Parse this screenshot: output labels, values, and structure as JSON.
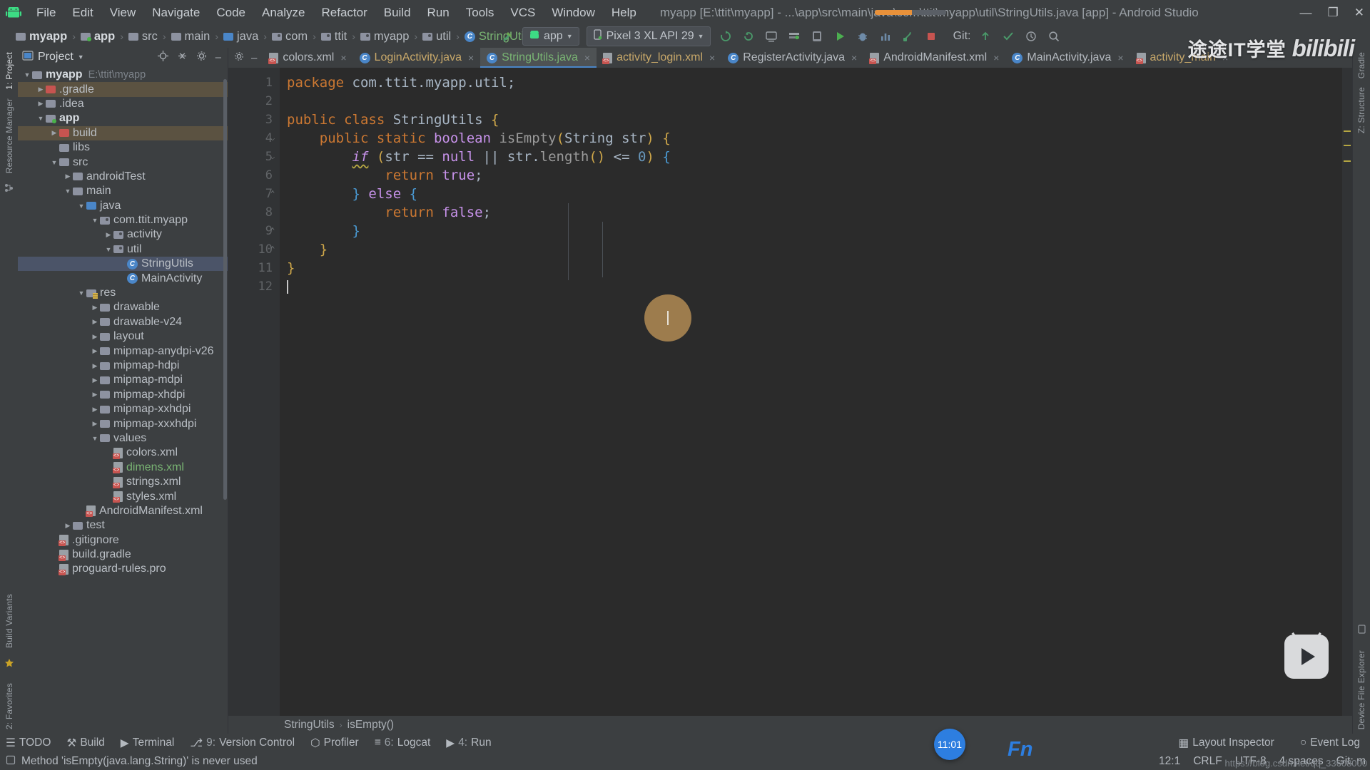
{
  "titlebar": {
    "app_icon": "android-robot-icon",
    "menus": [
      "File",
      "Edit",
      "View",
      "Navigate",
      "Code",
      "Analyze",
      "Refactor",
      "Build",
      "Run",
      "Tools",
      "VCS",
      "Window",
      "Help"
    ],
    "window_title": "myapp [E:\\ttit\\myapp] - ...\\app\\src\\main\\java\\com\\ttit\\myapp\\util\\StringUtils.java [app] - Android Studio",
    "window_controls": [
      "minimize-button",
      "maximize-button",
      "close-button"
    ],
    "controls_glyphs": {
      "minimize": "—",
      "maximize": "❐",
      "close": "✕"
    }
  },
  "navbar": {
    "breadcrumbs": [
      {
        "label": "myapp",
        "icon": "folder-module-icon"
      },
      {
        "label": "app",
        "icon": "folder-app-icon"
      },
      {
        "label": "src",
        "icon": "folder-icon"
      },
      {
        "label": "main",
        "icon": "folder-icon"
      },
      {
        "label": "java",
        "icon": "folder-source-icon"
      },
      {
        "label": "com",
        "icon": "package-icon"
      },
      {
        "label": "ttit",
        "icon": "package-icon"
      },
      {
        "label": "myapp",
        "icon": "package-icon"
      },
      {
        "label": "util",
        "icon": "package-icon"
      },
      {
        "label": "StringUtils",
        "icon": "class-icon"
      }
    ],
    "separator": "›",
    "module_selector": "app",
    "device_selector": "Pixel 3 XL API 29",
    "git_label": "Git:",
    "toolbar_icons": [
      "build-hammer-icon",
      "sync-gradle-icon",
      "avd-manager-icon",
      "sdk-manager-icon",
      "run-icon",
      "debug-icon",
      "profiler-icon",
      "attach-debugger-icon",
      "stop-icon",
      "search-icon",
      "layout-inspector-icon",
      "device-file-explorer-icon"
    ]
  },
  "project_panel": {
    "title": "Project",
    "header_icons": [
      "target-locate-icon",
      "collapse-all-icon",
      "settings-gear-icon",
      "hide-panel-icon"
    ],
    "tree": [
      {
        "label": "myapp",
        "path": "E:\\ttit\\myapp",
        "depth": 0,
        "arrow": "down",
        "icon": "folder-module-icon",
        "style": "bold"
      },
      {
        "label": ".gradle",
        "depth": 1,
        "arrow": "right",
        "icon": "folder-excluded-icon",
        "style": "highlight"
      },
      {
        "label": ".idea",
        "depth": 1,
        "arrow": "right",
        "icon": "folder-icon"
      },
      {
        "label": "app",
        "depth": 1,
        "arrow": "down",
        "icon": "folder-app-icon",
        "style": "bold"
      },
      {
        "label": "build",
        "depth": 2,
        "arrow": "right",
        "icon": "folder-excluded-icon",
        "style": "highlight"
      },
      {
        "label": "libs",
        "depth": 2,
        "arrow": "none",
        "icon": "folder-icon"
      },
      {
        "label": "src",
        "depth": 2,
        "arrow": "down",
        "icon": "folder-icon"
      },
      {
        "label": "androidTest",
        "depth": 3,
        "arrow": "right",
        "icon": "folder-icon"
      },
      {
        "label": "main",
        "depth": 3,
        "arrow": "down",
        "icon": "folder-icon"
      },
      {
        "label": "java",
        "depth": 4,
        "arrow": "down",
        "icon": "folder-source-icon"
      },
      {
        "label": "com.ttit.myapp",
        "depth": 5,
        "arrow": "down",
        "icon": "package-icon"
      },
      {
        "label": "activity",
        "depth": 6,
        "arrow": "right",
        "icon": "package-icon"
      },
      {
        "label": "util",
        "depth": 6,
        "arrow": "down",
        "icon": "package-icon"
      },
      {
        "label": "StringUtils",
        "depth": 7,
        "arrow": "none",
        "icon": "class-icon",
        "style": "selected"
      },
      {
        "label": "MainActivity",
        "depth": 7,
        "arrow": "none",
        "icon": "class-icon"
      },
      {
        "label": "res",
        "depth": 4,
        "arrow": "down",
        "icon": "folder-res-icon"
      },
      {
        "label": "drawable",
        "depth": 5,
        "arrow": "right",
        "icon": "folder-icon"
      },
      {
        "label": "drawable-v24",
        "depth": 5,
        "arrow": "right",
        "icon": "folder-icon"
      },
      {
        "label": "layout",
        "depth": 5,
        "arrow": "right",
        "icon": "folder-icon"
      },
      {
        "label": "mipmap-anydpi-v26",
        "depth": 5,
        "arrow": "right",
        "icon": "folder-icon"
      },
      {
        "label": "mipmap-hdpi",
        "depth": 5,
        "arrow": "right",
        "icon": "folder-icon"
      },
      {
        "label": "mipmap-mdpi",
        "depth": 5,
        "arrow": "right",
        "icon": "folder-icon"
      },
      {
        "label": "mipmap-xhdpi",
        "depth": 5,
        "arrow": "right",
        "icon": "folder-icon"
      },
      {
        "label": "mipmap-xxhdpi",
        "depth": 5,
        "arrow": "right",
        "icon": "folder-icon"
      },
      {
        "label": "mipmap-xxxhdpi",
        "depth": 5,
        "arrow": "right",
        "icon": "folder-icon"
      },
      {
        "label": "values",
        "depth": 5,
        "arrow": "down",
        "icon": "folder-icon"
      },
      {
        "label": "colors.xml",
        "depth": 6,
        "arrow": "none",
        "icon": "xml-file-icon"
      },
      {
        "label": "dimens.xml",
        "depth": 6,
        "arrow": "none",
        "icon": "xml-file-icon",
        "style": "green"
      },
      {
        "label": "strings.xml",
        "depth": 6,
        "arrow": "none",
        "icon": "xml-file-icon"
      },
      {
        "label": "styles.xml",
        "depth": 6,
        "arrow": "none",
        "icon": "xml-file-icon"
      },
      {
        "label": "AndroidManifest.xml",
        "depth": 4,
        "arrow": "none",
        "icon": "manifest-file-icon"
      },
      {
        "label": "test",
        "depth": 3,
        "arrow": "right",
        "icon": "folder-icon"
      },
      {
        "label": ".gitignore",
        "depth": 2,
        "arrow": "none",
        "icon": "gitignore-file-icon"
      },
      {
        "label": "build.gradle",
        "depth": 2,
        "arrow": "none",
        "icon": "gradle-file-icon"
      },
      {
        "label": "proguard-rules.pro",
        "depth": 2,
        "arrow": "none",
        "icon": "text-file-icon"
      }
    ]
  },
  "left_rail": [
    "1: Project",
    "Resource Manager",
    "Build Variants",
    "2: Favorites"
  ],
  "right_rail": [
    "Gradle",
    "Z: Structure",
    "Device File Explorer"
  ],
  "editor": {
    "tab_controls": [
      "settings-gear-icon",
      "hide-editor-icon"
    ],
    "tabs": [
      {
        "label": "colors.xml",
        "icon": "xml-file-icon",
        "active": false,
        "color": "plain",
        "close": "×"
      },
      {
        "label": "LoginActivity.java",
        "icon": "class-icon",
        "active": false,
        "color": "orange",
        "close": "×"
      },
      {
        "label": "StringUtils.java",
        "icon": "class-icon",
        "active": true,
        "color": "green",
        "close": "×"
      },
      {
        "label": "activity_login.xml",
        "icon": "xml-file-icon",
        "active": false,
        "color": "orange",
        "close": "×"
      },
      {
        "label": "RegisterActivity.java",
        "icon": "class-icon",
        "active": false,
        "color": "plain",
        "close": "×"
      },
      {
        "label": "AndroidManifest.xml",
        "icon": "manifest-file-icon",
        "active": false,
        "color": "plain",
        "close": "×"
      },
      {
        "label": "MainActivity.java",
        "icon": "class-icon",
        "active": false,
        "color": "plain",
        "close": "×"
      },
      {
        "label": "activity_main",
        "icon": "xml-file-icon",
        "active": false,
        "color": "orange",
        "close": "×"
      }
    ],
    "line_numbers": [
      "1",
      "2",
      "3",
      "4",
      "5",
      "6",
      "7",
      "8",
      "9",
      "10",
      "11",
      "12"
    ],
    "code_lines": [
      "package com.ttit.myapp.util;",
      "",
      "public class StringUtils {",
      "    public static boolean isEmpty(String str) {",
      "        if (str == null || str.length() <= 0) {",
      "            return true;",
      "        } else {",
      "            return false;",
      "        }",
      "    }",
      "}",
      ""
    ],
    "breadcrumb_footer": [
      "StringUtils",
      "isEmpty()"
    ],
    "breadcrumb_sep": "›"
  },
  "bottom_tools": [
    {
      "label": "TODO",
      "icon": "todo-icon",
      "key": ""
    },
    {
      "label": "Build",
      "icon": "build-hammer-icon",
      "key": ""
    },
    {
      "label": "Terminal",
      "icon": "terminal-icon",
      "key": ""
    },
    {
      "label": "Version Control",
      "icon": "vcs-icon",
      "key": "9:"
    },
    {
      "label": "Profiler",
      "icon": "profiler-icon",
      "key": ""
    },
    {
      "label": "Logcat",
      "icon": "logcat-icon",
      "key": "6:"
    },
    {
      "label": "Run",
      "icon": "run-icon",
      "key": "4:"
    }
  ],
  "bottom_right_tools": [
    {
      "label": "Layout Inspector",
      "icon": "layout-inspector-icon"
    },
    {
      "label": "Event Log",
      "icon": "event-log-icon"
    }
  ],
  "statusbar": {
    "message": "Method 'isEmpty(java.lang.String)' is never used",
    "icon": "inspection-icon",
    "caret_position": "12:1",
    "line_separator": "CRLF",
    "encoding": "UTF-8",
    "indent": "4 spaces",
    "git_branch": "Git: m"
  },
  "overlays": {
    "watermark_cn": "途途IT学堂",
    "watermark_en": "bilibili",
    "play_badge": "bilibili-tv-logo",
    "clock": "11:01",
    "fn_badge": "Fn",
    "blog_url": "https://blog.csdn.net/qq_33608000"
  },
  "colors": {
    "chrome": "#3c3f41",
    "editor_bg": "#2b2b2b",
    "accent_blue": "#4a86c8",
    "accent_green": "#79b473",
    "accent_orange": "#e8913a",
    "selection": "#4b5468",
    "keyword": "#cc7832",
    "number": "#6897bb"
  }
}
